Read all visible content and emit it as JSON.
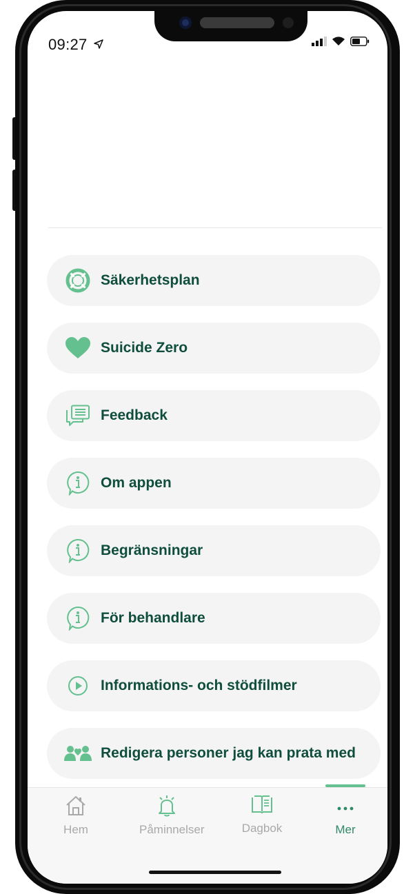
{
  "status_bar": {
    "time": "09:27"
  },
  "menu": {
    "items": [
      {
        "label": "Säkerhetsplan",
        "icon": "lifebuoy-icon"
      },
      {
        "label": "Suicide Zero",
        "icon": "heart-icon"
      },
      {
        "label": "Feedback",
        "icon": "chat-bubbles-icon"
      },
      {
        "label": "Om appen",
        "icon": "info-bubble-icon"
      },
      {
        "label": "Begränsningar",
        "icon": "info-bubble-icon"
      },
      {
        "label": "För behandlare",
        "icon": "info-bubble-icon"
      },
      {
        "label": "Informations- och stödfilmer",
        "icon": "play-circle-icon"
      },
      {
        "label": "Redigera personer jag kan prata med",
        "icon": "people-heart-icon"
      }
    ]
  },
  "tabs": [
    {
      "label": "Hem",
      "icon": "home-icon",
      "active": false
    },
    {
      "label": "Påminnelser",
      "icon": "bell-icon",
      "active": false
    },
    {
      "label": "Dagbok",
      "icon": "book-icon",
      "active": false
    },
    {
      "label": "Mer",
      "icon": "more-dots-icon",
      "active": true
    }
  ],
  "colors": {
    "accent": "#64c08e",
    "text_dark_green": "#0f4d3c",
    "tab_inactive": "#a9a9a9",
    "item_background": "#f4f4f4"
  }
}
